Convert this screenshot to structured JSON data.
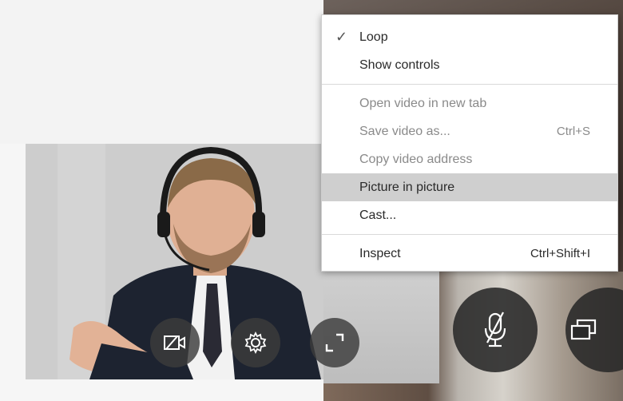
{
  "context_menu": {
    "items": [
      {
        "label": "Loop",
        "checked": true,
        "enabled": true,
        "shortcut": ""
      },
      {
        "label": "Show controls",
        "checked": false,
        "enabled": true,
        "shortcut": ""
      },
      {
        "label": "Open video in new tab",
        "enabled": false,
        "shortcut": ""
      },
      {
        "label": "Save video as...",
        "enabled": false,
        "shortcut": "Ctrl+S"
      },
      {
        "label": "Copy video address",
        "enabled": false,
        "shortcut": ""
      },
      {
        "label": "Picture in picture",
        "enabled": true,
        "highlighted": true,
        "shortcut": ""
      },
      {
        "label": "Cast...",
        "enabled": true,
        "shortcut": ""
      },
      {
        "label": "Inspect",
        "enabled": true,
        "shortcut": "Ctrl+Shift+I"
      }
    ],
    "check_glyph": "✓",
    "highlight_color": "#cfcfcf"
  },
  "video_controls": {
    "left": [
      "camera-off-icon",
      "gear-icon",
      "fullscreen-icon"
    ],
    "right": [
      "mic-muted-icon",
      "screen-share-icon"
    ]
  }
}
